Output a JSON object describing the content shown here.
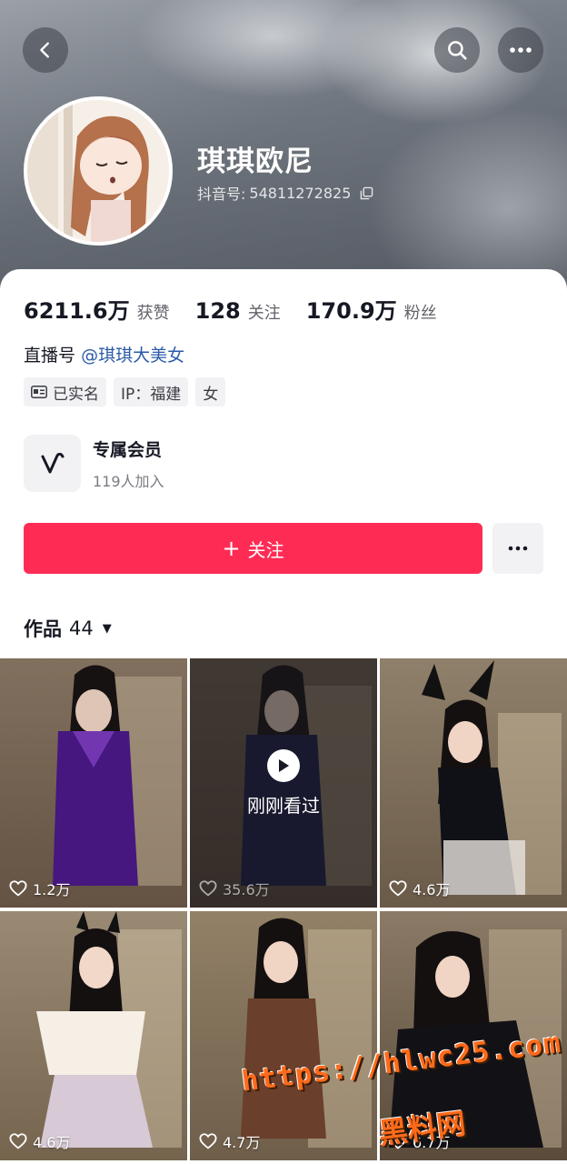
{
  "profile": {
    "nickname": "琪琪欧尼",
    "douyin_id_label": "抖音号:",
    "douyin_id": "54811272825",
    "stats": [
      {
        "num": "6211.6万",
        "label": "获赞"
      },
      {
        "num": "128",
        "label": "关注"
      },
      {
        "num": "170.9万",
        "label": "粉丝"
      }
    ],
    "live_prefix": "直播号",
    "live_handle": "@琪琪大美女",
    "tags": [
      "已实名",
      "IP：福建",
      "女"
    ]
  },
  "member": {
    "title": "专属会员",
    "subtitle": "119人加入"
  },
  "actions": {
    "follow_label": "关注",
    "follow_plus": "+"
  },
  "works": {
    "label": "作品",
    "count": "44"
  },
  "videos": [
    {
      "likes": "1.2万"
    },
    {
      "likes": "35.6万",
      "recent_label": "刚刚看过"
    },
    {
      "likes": "4.6万"
    },
    {
      "likes": "4.6万"
    },
    {
      "likes": "4.7万"
    },
    {
      "likes": "6.7万"
    }
  ],
  "watermark": {
    "url": "https://hlwc25.com",
    "name": "黑料网"
  },
  "colors": {
    "accent": "#fe2c55",
    "link": "#2b5ba8"
  }
}
